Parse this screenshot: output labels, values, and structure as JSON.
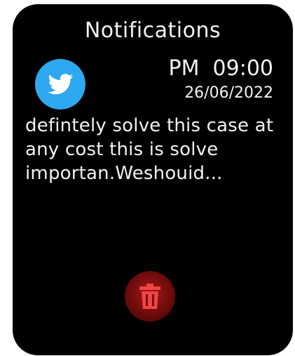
{
  "header": {
    "title": "Notifications"
  },
  "notification": {
    "app_icon": "twitter-bird-icon",
    "time": "PM  09:00",
    "date": "26/06/2022",
    "message": "defintely solve this case at any cost this is solve importan.Weshouid..."
  },
  "actions": {
    "delete_icon": "trash-icon"
  },
  "colors": {
    "background": "#000000",
    "text": "#f2f2f2",
    "twitter_blue": "#2ea8f0",
    "delete_red": "#e03a3a"
  }
}
